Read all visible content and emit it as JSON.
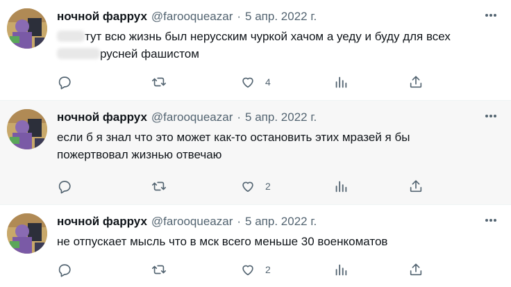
{
  "tweets": [
    {
      "name": "ночной фаррух",
      "handle": "@farooqueazar",
      "separator": "·",
      "date": "5 апр. 2022 г.",
      "text_line1": "тут всю жизнь был нерусским чуркой хачом а уеду и буду для всех",
      "text_line2": "русней фашистом",
      "reply_count": "",
      "retweet_count": "",
      "like_count": "4"
    },
    {
      "name": "ночной фаррух",
      "handle": "@farooqueazar",
      "separator": "·",
      "date": "5 апр. 2022 г.",
      "text_line1": "если б я знал что это может как-то остановить этих мразей я бы",
      "text_line2": "пожертвовал жизнью отвечаю",
      "reply_count": "",
      "retweet_count": "",
      "like_count": "2"
    },
    {
      "name": "ночной фаррух",
      "handle": "@farooqueazar",
      "separator": "·",
      "date": "5 апр. 2022 г.",
      "text_line1": "не отпускает мысль что в мск всего меньше 30 военкоматов",
      "text_line2": "",
      "reply_count": "",
      "retweet_count": "",
      "like_count": "2"
    }
  ],
  "icons": {
    "more": "more-horizontal-icon",
    "reply": "reply-bubble-icon",
    "retweet": "retweet-icon",
    "like": "heart-icon",
    "views": "bar-chart-icon",
    "share": "share-upload-icon"
  },
  "colors": {
    "text": "#0f1419",
    "secondary": "#536471",
    "hover_bg": "#f7f7f7",
    "divider": "#eff3f4"
  }
}
